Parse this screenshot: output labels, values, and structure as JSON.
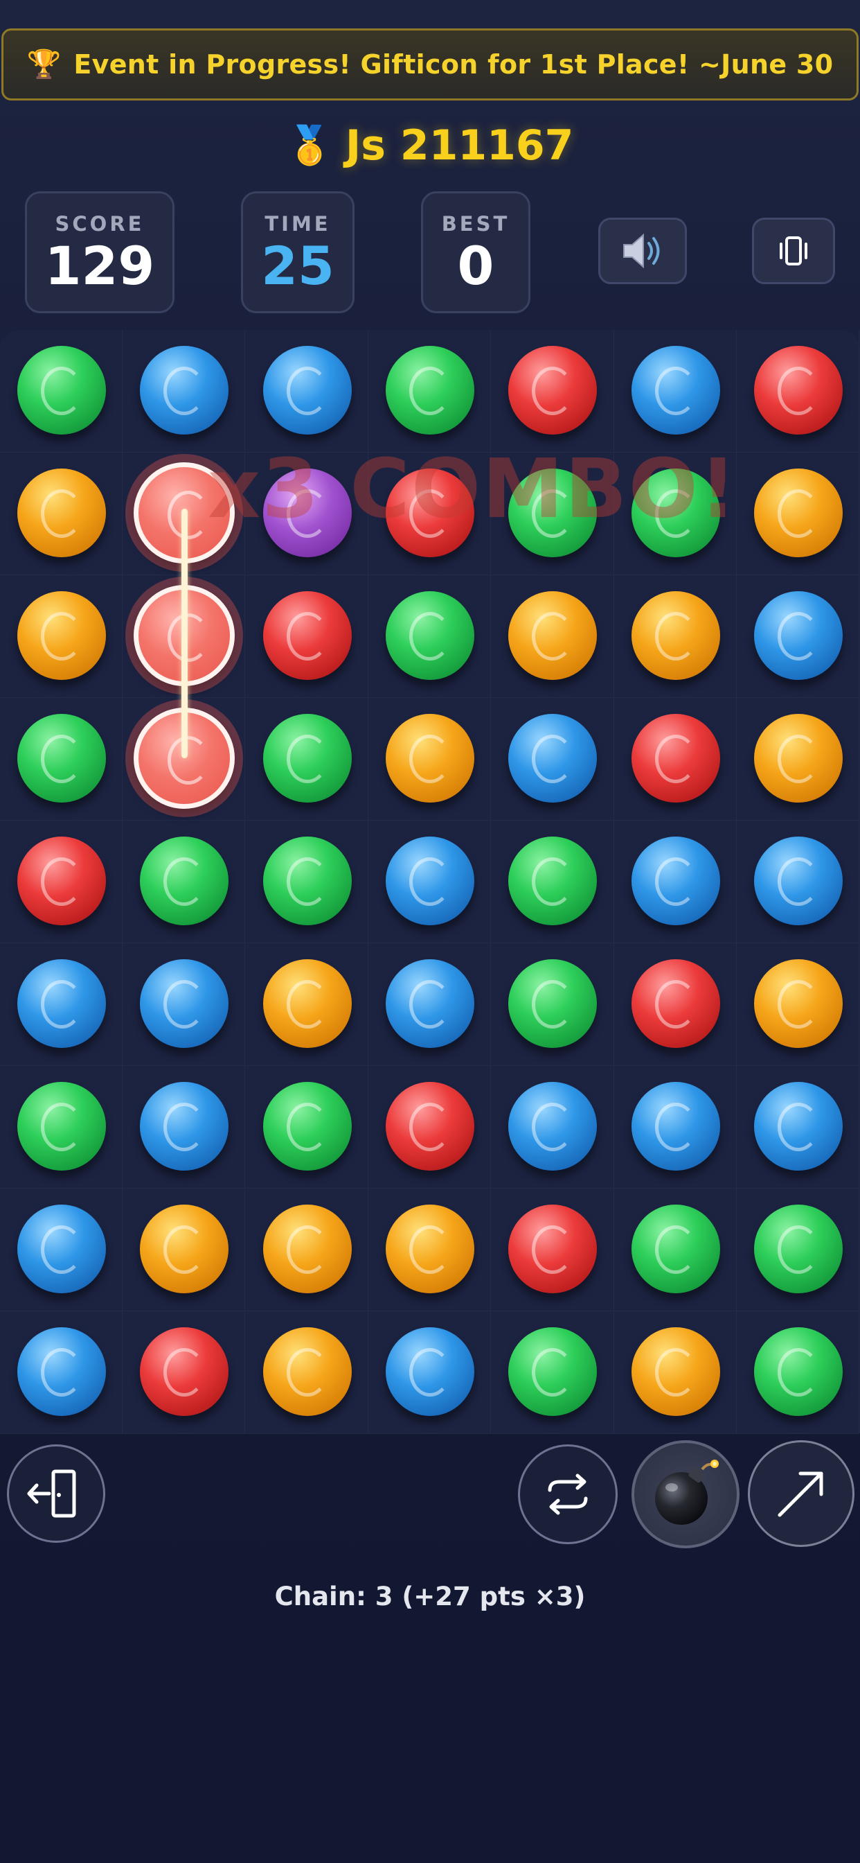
{
  "banner": {
    "trophy_icon": "trophy-icon",
    "text": "Event in Progress! Gifticon for 1st Place! ~June 30"
  },
  "player": {
    "medal_icon": "gold-medal-icon",
    "name": "Js 211167"
  },
  "stats": {
    "score": {
      "label": "SCORE",
      "value": "129"
    },
    "time": {
      "label": "TIME",
      "value": "25"
    },
    "best": {
      "label": "BEST",
      "value": "0"
    }
  },
  "toolbar": {
    "sound_icon": "speaker-icon",
    "vibration_icon": "vibration-icon"
  },
  "combo_text": "x3 COMBO!",
  "board": {
    "columns": 7,
    "rows": 9,
    "grid": [
      [
        "green",
        "blue",
        "blue",
        "green",
        "red",
        "blue",
        "red"
      ],
      [
        "orange",
        "red",
        "purple",
        "red",
        "green",
        "green",
        "orange"
      ],
      [
        "orange",
        "red",
        "red",
        "green",
        "orange",
        "orange",
        "blue"
      ],
      [
        "green",
        "red",
        "green",
        "orange",
        "blue",
        "red",
        "orange"
      ],
      [
        "red",
        "green",
        "green",
        "blue",
        "green",
        "blue",
        "blue"
      ],
      [
        "blue",
        "blue",
        "orange",
        "blue",
        "green",
        "red",
        "orange"
      ],
      [
        "green",
        "blue",
        "green",
        "red",
        "blue",
        "blue",
        "blue"
      ],
      [
        "blue",
        "orange",
        "orange",
        "orange",
        "red",
        "green",
        "green"
      ],
      [
        "blue",
        "red",
        "orange",
        "blue",
        "green",
        "orange",
        "green"
      ]
    ],
    "selected": [
      [
        1,
        1
      ],
      [
        2,
        1
      ],
      [
        3,
        1
      ]
    ]
  },
  "controls": {
    "exit_icon": "exit-door-icon",
    "shuffle_icon": "shuffle-icon",
    "bomb_icon": "bomb-icon",
    "arrow_icon": "diagonal-arrow-icon"
  },
  "status": {
    "chain_text": "Chain: 3 (+27 pts ×3)"
  },
  "colors": {
    "accent_gold": "#f9d11d",
    "time_blue": "#4ab4f2",
    "selected_red": "#e8564c"
  }
}
